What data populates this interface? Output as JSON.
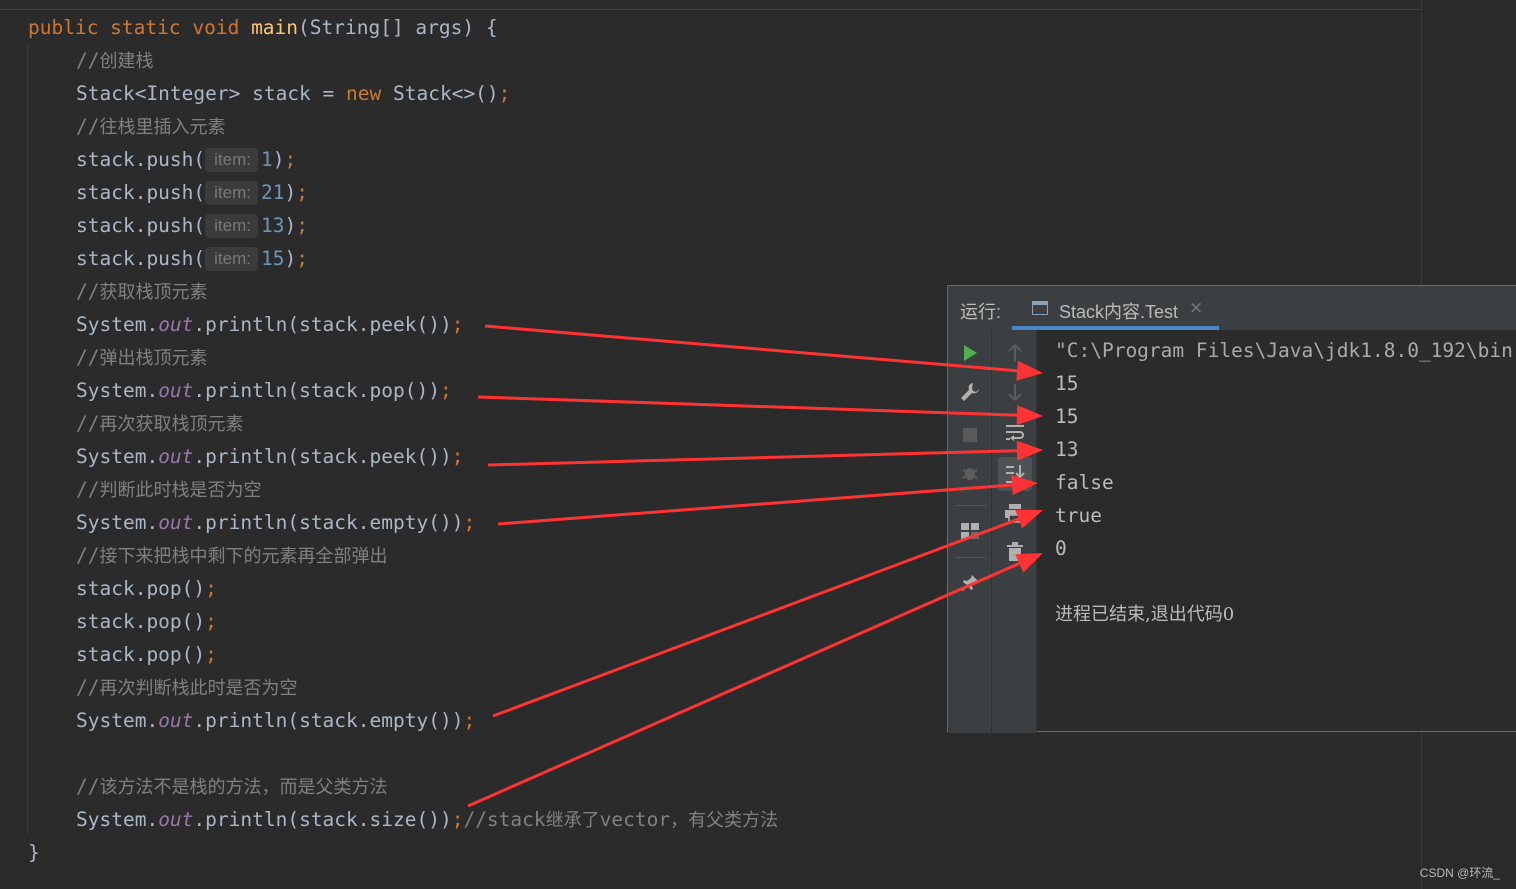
{
  "editor": {
    "lines": [
      {
        "kind": "sig",
        "kw1": "public static void ",
        "name": "main",
        "rest": "(String[] args) {"
      },
      {
        "kind": "comment",
        "text": "//创建栈"
      },
      {
        "kind": "decl",
        "a": "Stack<Integer> stack = ",
        "kw": "new",
        "b": " Stack<>()",
        "semi": ";"
      },
      {
        "kind": "comment",
        "text": "//往栈里插入元素"
      },
      {
        "kind": "push",
        "call": "stack.push(",
        "hint": "item:",
        "num": "1",
        "close": ")",
        "semi": ";"
      },
      {
        "kind": "push",
        "call": "stack.push(",
        "hint": "item:",
        "num": "21",
        "close": ")",
        "semi": ";"
      },
      {
        "kind": "push",
        "call": "stack.push(",
        "hint": "item:",
        "num": "13",
        "close": ")",
        "semi": ";"
      },
      {
        "kind": "push",
        "call": "stack.push(",
        "hint": "item:",
        "num": "15",
        "close": ")",
        "semi": ";"
      },
      {
        "kind": "comment",
        "text": "//获取栈顶元素"
      },
      {
        "kind": "print",
        "pre": "System.",
        "field": "out",
        "post": ".println(stack.peek())",
        "semi": ";"
      },
      {
        "kind": "comment",
        "text": "//弹出栈顶元素"
      },
      {
        "kind": "print",
        "pre": "System.",
        "field": "out",
        "post": ".println(stack.pop())",
        "semi": ";"
      },
      {
        "kind": "comment",
        "text": "//再次获取栈顶元素"
      },
      {
        "kind": "print",
        "pre": "System.",
        "field": "out",
        "post": ".println(stack.peek())",
        "semi": ";"
      },
      {
        "kind": "comment",
        "text": "//判断此时栈是否为空"
      },
      {
        "kind": "print",
        "pre": "System.",
        "field": "out",
        "post": ".println(stack.empty())",
        "semi": ";"
      },
      {
        "kind": "comment",
        "text": "//接下来把栈中剩下的元素再全部弹出"
      },
      {
        "kind": "plain",
        "text": "stack.pop()",
        "semi": ";"
      },
      {
        "kind": "plain",
        "text": "stack.pop()",
        "semi": ";"
      },
      {
        "kind": "plain",
        "text": "stack.pop()",
        "semi": ";"
      },
      {
        "kind": "comment",
        "text": "//再次判断栈此时是否为空"
      },
      {
        "kind": "print",
        "pre": "System.",
        "field": "out",
        "post": ".println(stack.empty())",
        "semi": ";"
      },
      {
        "kind": "blank"
      },
      {
        "kind": "comment",
        "text": "//该方法不是栈的方法，而是父类方法"
      },
      {
        "kind": "print_cm",
        "pre": "System.",
        "field": "out",
        "post": ".println(stack.size())",
        "semi": ";",
        "cm1": "//stack",
        "cm2": "继承了",
        "cm3": "vector",
        "cm4": "，有父类方法"
      },
      {
        "kind": "close",
        "text": "}"
      }
    ]
  },
  "run_panel": {
    "label": "运行:",
    "tab_title": "Stack内容.Test",
    "tab_close": "×",
    "console_lines": [
      "\"C:\\Program Files\\Java\\jdk1.8.0_192\\bin",
      "15",
      "15",
      "13",
      "false",
      "true",
      "0",
      "",
      "进程已结束,退出代码0"
    ],
    "toolbar_left": [
      "run-icon",
      "wrench-icon",
      "stop-icon",
      "bug-icon",
      "layout-icon",
      "pin-icon"
    ],
    "toolbar_right": [
      "arrow-up-icon",
      "arrow-down-icon",
      "soft-wrap-icon",
      "scroll-to-end-icon",
      "print-icon",
      "trash-icon"
    ]
  },
  "annotation_color": "#ff3333",
  "watermark": "CSDN @环流_"
}
